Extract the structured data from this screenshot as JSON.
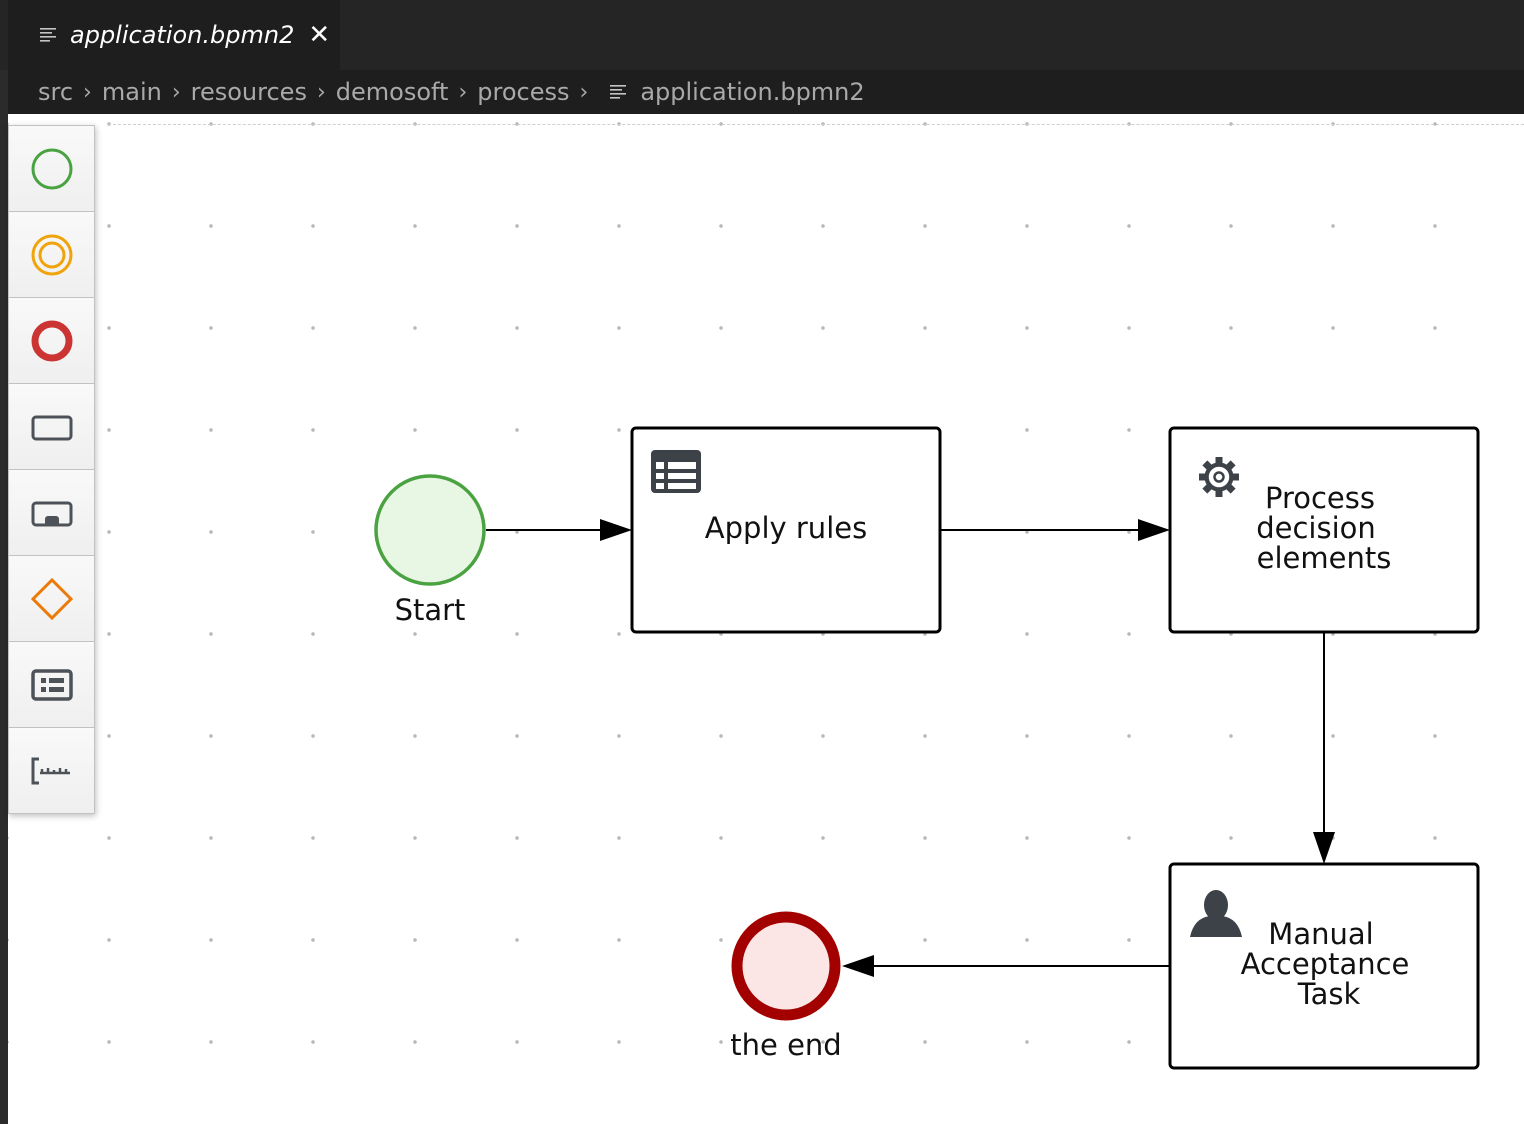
{
  "editor": {
    "tab": {
      "label": "application.bpmn2",
      "icon": "file-lines-icon",
      "close_icon": "close-icon",
      "close_glyph": "✕"
    },
    "breadcrumb": [
      {
        "label": "src"
      },
      {
        "label": "main"
      },
      {
        "label": "resources"
      },
      {
        "label": "demosoft"
      },
      {
        "label": "process"
      },
      {
        "label": "application.bpmn2",
        "icon": "file-lines-icon"
      }
    ],
    "breadcrumb_separator": "›"
  },
  "palette": {
    "items": [
      {
        "name": "start-event",
        "icon": "start-event-icon",
        "color": "#4aa241"
      },
      {
        "name": "intermediate-event",
        "icon": "intermediate-event-icon",
        "color": "#f0a30a"
      },
      {
        "name": "end-event",
        "icon": "end-event-icon",
        "color": "#cc3333"
      },
      {
        "name": "task",
        "icon": "task-icon",
        "color": "#4d5258"
      },
      {
        "name": "subprocess",
        "icon": "subprocess-icon",
        "color": "#4d5258"
      },
      {
        "name": "gateway",
        "icon": "gateway-icon",
        "color": "#ec7a08"
      },
      {
        "name": "lane",
        "icon": "lane-icon",
        "color": "#4d5258"
      },
      {
        "name": "annotation",
        "icon": "annotation-icon",
        "color": "#4d5258"
      }
    ]
  },
  "diagram": {
    "nodes": [
      {
        "id": "start",
        "type": "start-event",
        "label": "Start",
        "stroke": "#4aa241",
        "fill": "#e8f7e4"
      },
      {
        "id": "apply-rules",
        "type": "business-rule-task",
        "icon": "table-icon",
        "label_lines": [
          "Apply rules"
        ]
      },
      {
        "id": "process-decision",
        "type": "service-task",
        "icon": "gear-icon",
        "label_lines": [
          "Process",
          "decision",
          "elements"
        ]
      },
      {
        "id": "manual-acceptance",
        "type": "user-task",
        "icon": "user-icon",
        "label_lines": [
          "Manual",
          "Acceptance",
          "Task"
        ]
      },
      {
        "id": "end",
        "type": "end-event",
        "label": "the end",
        "stroke": "#a30000",
        "fill": "#fbe5e5"
      }
    ],
    "flows": [
      {
        "from": "start",
        "to": "apply-rules"
      },
      {
        "from": "apply-rules",
        "to": "process-decision"
      },
      {
        "from": "process-decision",
        "to": "manual-acceptance"
      },
      {
        "from": "manual-acceptance",
        "to": "end"
      }
    ]
  }
}
